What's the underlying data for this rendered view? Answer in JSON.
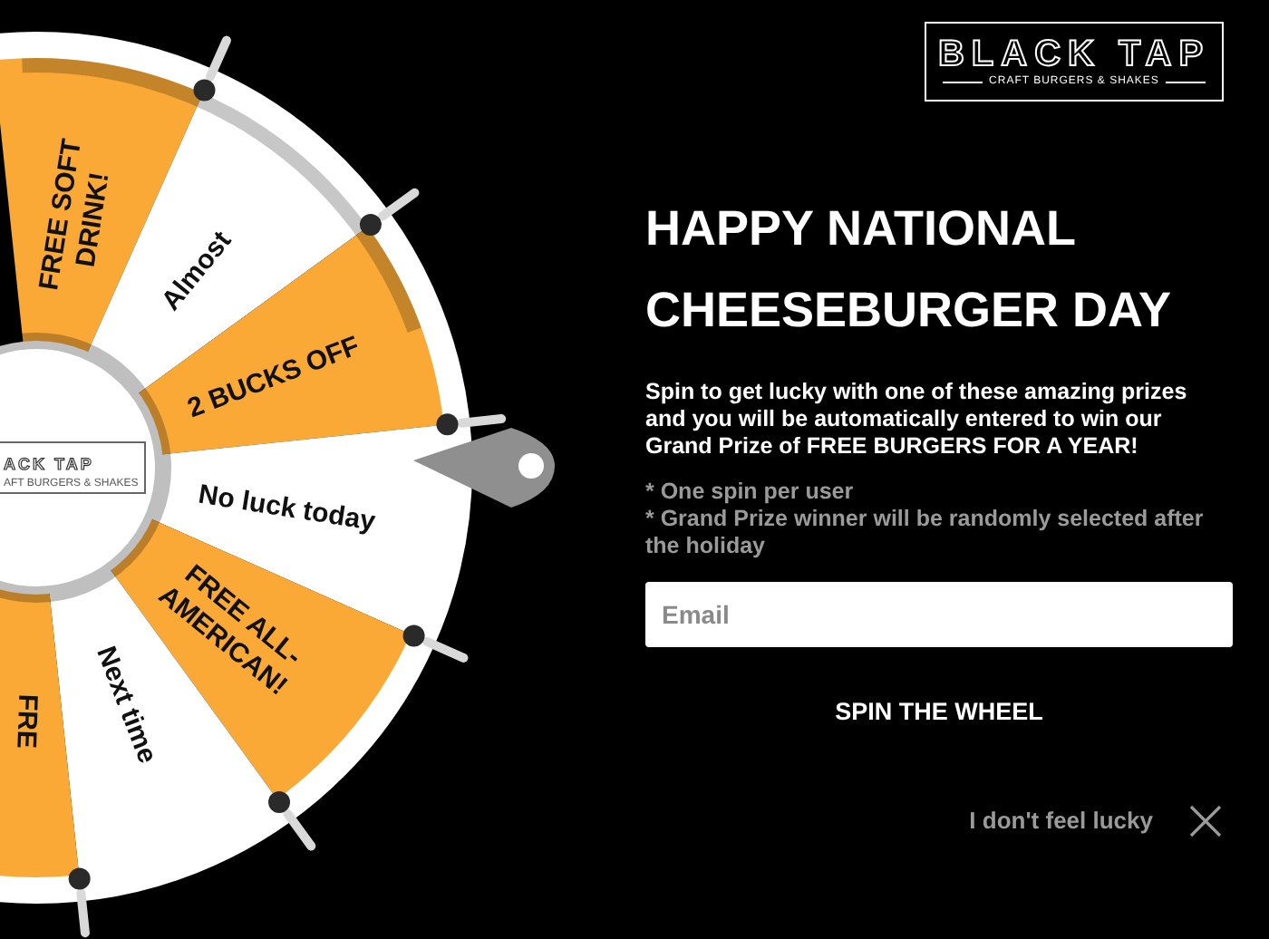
{
  "wheel": {
    "segments": [
      {
        "label": "FREE SOFT\nDRINK!",
        "color": "#fba936"
      },
      {
        "label": "Almost",
        "color": "#ffffff"
      },
      {
        "label": "2 BUCKS OFF",
        "color": "#fba936"
      },
      {
        "label": "No luck today",
        "color": "#ffffff"
      },
      {
        "label": "FREE ALL-\nAMERICAN!",
        "color": "#fba936"
      },
      {
        "label": "Next time",
        "color": "#ffffff"
      },
      {
        "label": "FRE",
        "color": "#fba936"
      }
    ],
    "hub_logo": {
      "name": "ACK TAP",
      "tagline": "AFT BURGERS & SHAKES"
    }
  },
  "logo": {
    "name": "BLACK TAP",
    "tagline": "CRAFT BURGERS & SHAKES"
  },
  "heading": "HAPPY NATIONAL CHEESEBURGER DAY",
  "intro": "Spin to get lucky with one of these amazing prizes and you will be automatically entered to win our Grand Prize of FREE BURGERS FOR A YEAR!",
  "notes": [
    "* One spin per user",
    "* Grand Prize winner will be randomly selected after the holiday"
  ],
  "email": {
    "placeholder": "Email"
  },
  "spin_button": "SPIN THE WHEEL",
  "decline_link": "I don't feel lucky"
}
